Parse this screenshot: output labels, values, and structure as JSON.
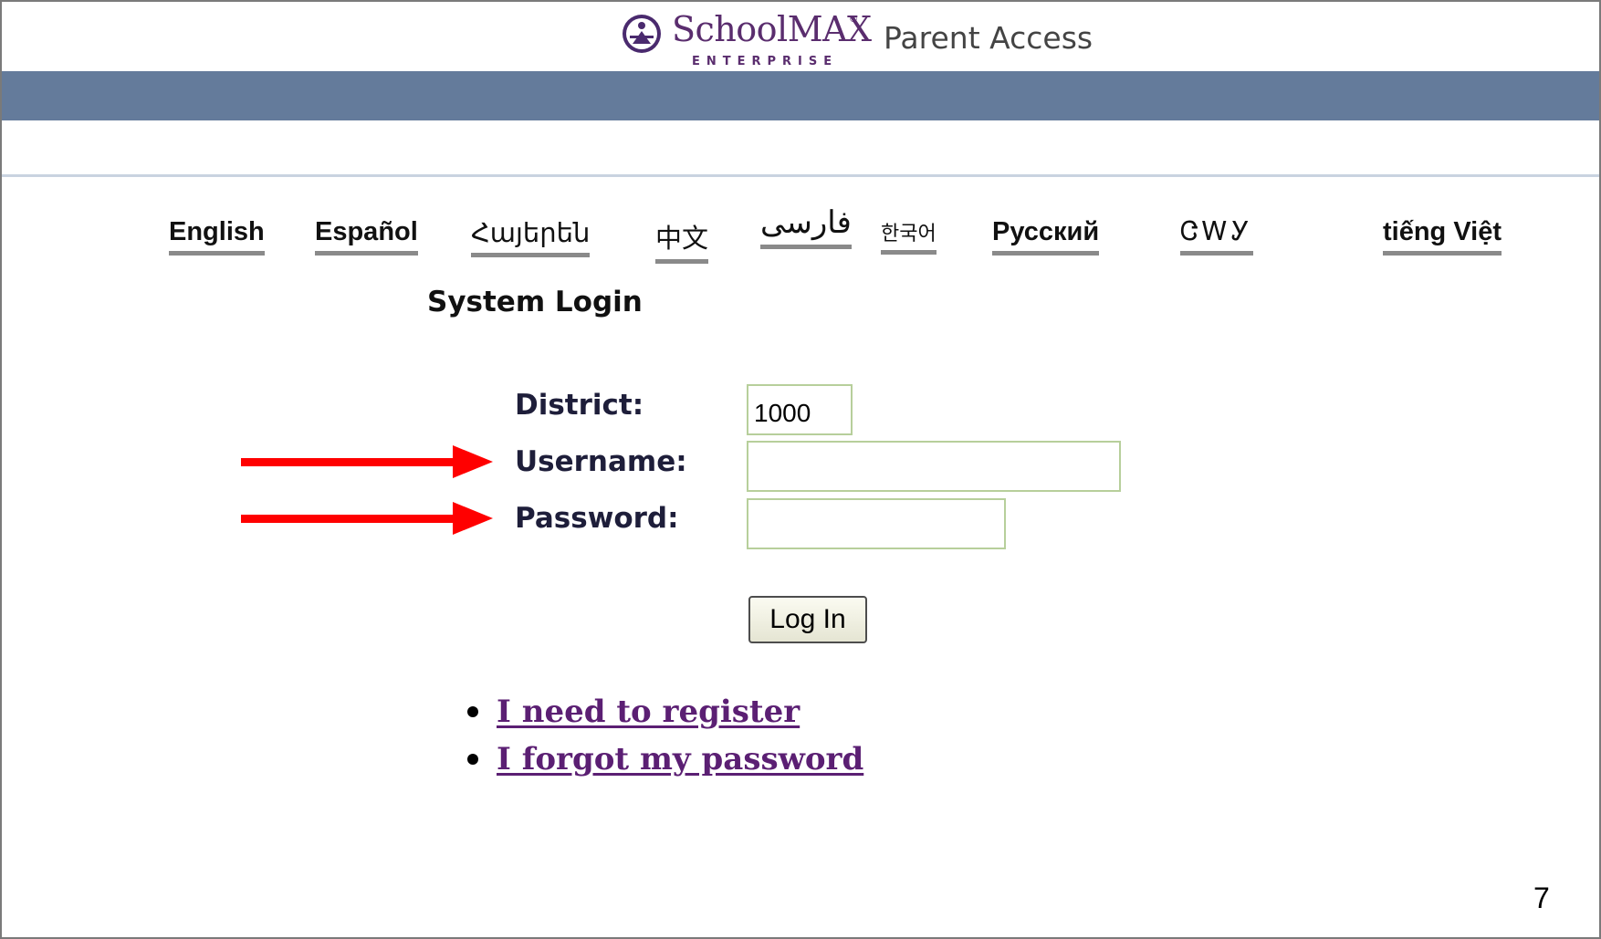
{
  "header": {
    "logo_name": "SchoolMAX",
    "logo_sub": "ENTERPRISE",
    "logo_reg": "®",
    "title": "Parent Access"
  },
  "languages": [
    {
      "label": "English"
    },
    {
      "label": "Español"
    },
    {
      "label": "Հայերեն"
    },
    {
      "label": "中文"
    },
    {
      "label": "فارسی"
    },
    {
      "label": "한국어"
    },
    {
      "label": "Русский"
    },
    {
      "label": "ᏣᎳᎩ"
    },
    {
      "label": "tiếng Việt"
    }
  ],
  "login": {
    "heading": "System Login",
    "district_label": "District:",
    "district_value": "1000",
    "username_label": "Username:",
    "username_value": "",
    "password_label": "Password:",
    "password_value": "",
    "button_label": "Log In"
  },
  "links": {
    "register": "I need to register",
    "forgot": "I forgot my password"
  },
  "annotations": {
    "arrow_color": "#ff0000"
  },
  "slide": {
    "page_number": "7"
  },
  "colors": {
    "banner": "#647b9b",
    "link": "#5b1f73",
    "field_border": "#b7cf9b"
  }
}
